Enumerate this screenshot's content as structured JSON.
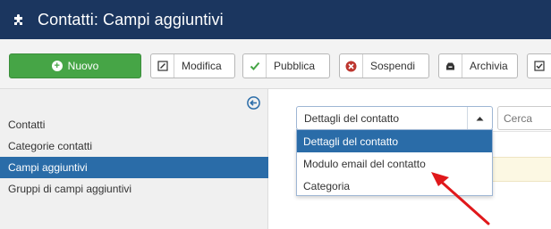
{
  "header": {
    "title": "Contatti: Campi aggiuntivi",
    "icon": "puzzle-icon"
  },
  "toolbar": {
    "new_label": "Nuovo",
    "edit_label": "Modifica",
    "publish_label": "Pubblica",
    "unpublish_label": "Sospendi",
    "archive_label": "Archivia"
  },
  "sidebar": {
    "items": [
      {
        "label": "Contatti"
      },
      {
        "label": "Categorie contatti"
      },
      {
        "label": "Campi aggiuntivi"
      },
      {
        "label": "Gruppi di campi aggiuntivi"
      }
    ]
  },
  "context_select": {
    "value": "Dettagli del contatto",
    "options": [
      {
        "label": "Dettagli del contatto"
      },
      {
        "label": "Modulo email del contatto"
      },
      {
        "label": "Categoria"
      }
    ]
  },
  "search": {
    "placeholder": "Cerca"
  },
  "colors": {
    "header_bg": "#1b365f",
    "new_button": "#46a546",
    "active_blue": "#2a6ca8",
    "arrow_red": "#e0181b"
  }
}
